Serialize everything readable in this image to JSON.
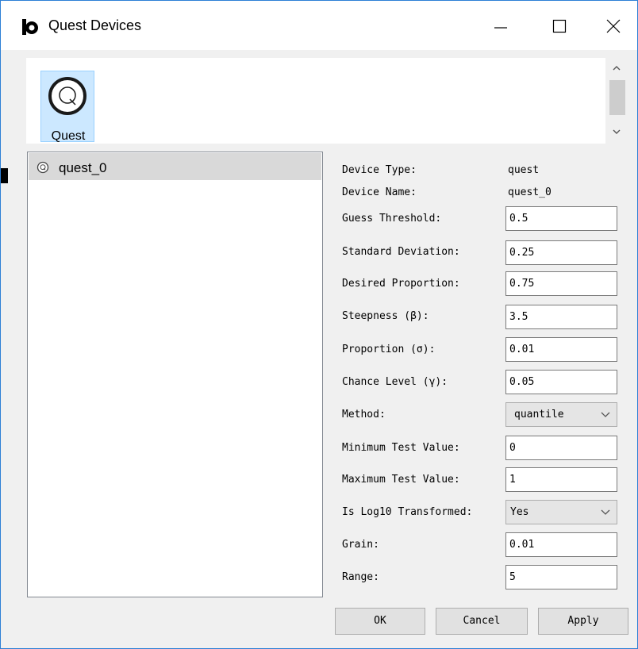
{
  "window": {
    "title": "Quest Devices",
    "controls": [
      "minimize-icon",
      "maximize-icon",
      "close-icon"
    ]
  },
  "device_types": [
    {
      "label": "Quest",
      "icon": "quest-icon",
      "selected": true
    }
  ],
  "device_list": [
    {
      "label": "quest_0",
      "icon": "quest-icon",
      "selected": true
    }
  ],
  "properties": {
    "device_type": {
      "label": "Device Type:",
      "value": "quest"
    },
    "device_name": {
      "label": "Device Name:",
      "value": "quest_0"
    },
    "guess_threshold": {
      "label": "Guess Threshold:",
      "value": "0.5"
    },
    "standard_deviation": {
      "label": "Standard Deviation:",
      "value": "0.25"
    },
    "desired_proportion": {
      "label": "Desired Proportion:",
      "value": "0.75"
    },
    "steepness": {
      "label": "Steepness (β):",
      "value": "3.5"
    },
    "proportion": {
      "label": "Proportion (σ):",
      "value": "0.01"
    },
    "chance_level": {
      "label": "Chance Level (γ):",
      "value": "0.05"
    },
    "method": {
      "label": "Method:",
      "value": "quantile"
    },
    "minimum_test_value": {
      "label": "Minimum Test Value:",
      "value": "0"
    },
    "maximum_test_value": {
      "label": "Maximum Test Value:",
      "value": "1"
    },
    "is_log10_transformed": {
      "label": "Is Log10 Transformed:",
      "value": "Yes"
    },
    "grain": {
      "label": "Grain:",
      "value": "0.01"
    },
    "range": {
      "label": "Range:",
      "value": "5"
    }
  },
  "buttons": {
    "ok": "OK",
    "cancel": "Cancel",
    "apply": "Apply"
  },
  "colors": {
    "selection": "#cce8ff",
    "list_selection": "#d9d9d9",
    "window_border": "#2d7fd6"
  }
}
